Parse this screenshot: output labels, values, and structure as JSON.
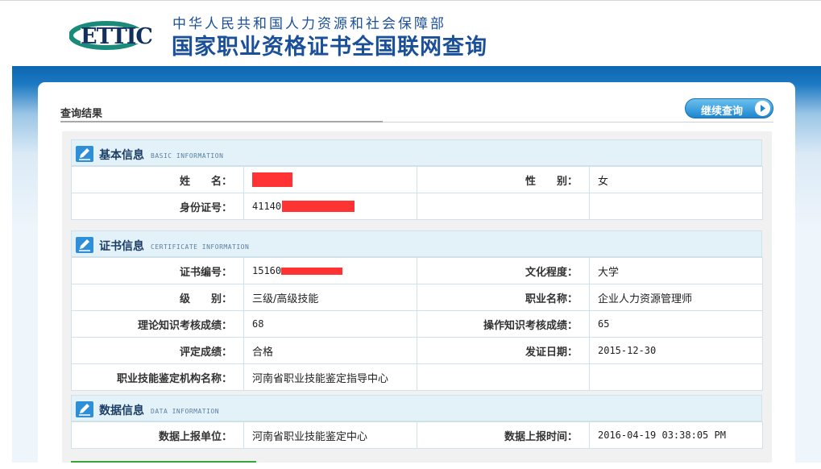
{
  "header": {
    "logo_text": "ETTIC",
    "org_name": "中华人民共和国人力资源和社会保障部",
    "site_title": "国家职业资格证书全国联网查询"
  },
  "page": {
    "result_title": "查询结果",
    "continue_button": "继续查询"
  },
  "basic": {
    "title": "基本信息",
    "subtitle": "BASIC INFORMATION",
    "rows": [
      {
        "label": "姓　　名：",
        "value": "",
        "label2": "性　　别：",
        "value2": "女"
      },
      {
        "label": "身份证号：",
        "value": "41140",
        "label2": "",
        "value2": ""
      }
    ]
  },
  "certificate": {
    "title": "证书信息",
    "subtitle": "CERTIFICATE INFORMATION",
    "rows": [
      {
        "label": "证书编号：",
        "value": "15160",
        "label2": "文化程度：",
        "value2": "大学"
      },
      {
        "label": "级　　别：",
        "value": "三级/高级技能",
        "label2": "职业名称：",
        "value2": "企业人力资源管理师"
      },
      {
        "label": "理论知识考核成绩：",
        "value": "68",
        "label2": "操作知识考核成绩：",
        "value2": "65"
      },
      {
        "label": "评定成绩：",
        "value": "合格",
        "label2": "发证日期：",
        "value2": "2015-12-30"
      },
      {
        "label": "职业技能鉴定机构名称：",
        "value": "河南省职业技能鉴定指导中心",
        "label2": "",
        "value2": ""
      }
    ]
  },
  "datainfo": {
    "title": "数据信息",
    "subtitle": "DATA INFORMATION",
    "rows": [
      {
        "label": "数据上报单位：",
        "value": "河南省职业技能鉴定中心",
        "label2": "数据上报时间：",
        "value2": "2016-04-19 03:38:05 PM"
      }
    ]
  },
  "colors": {
    "brand_blue": "#1a4f9a",
    "logo_green": "#1a8a7a",
    "redaction": "#ff3333"
  },
  "icons": [
    "ettic-logo",
    "edit-icon",
    "arrow-right-circle-icon"
  ]
}
